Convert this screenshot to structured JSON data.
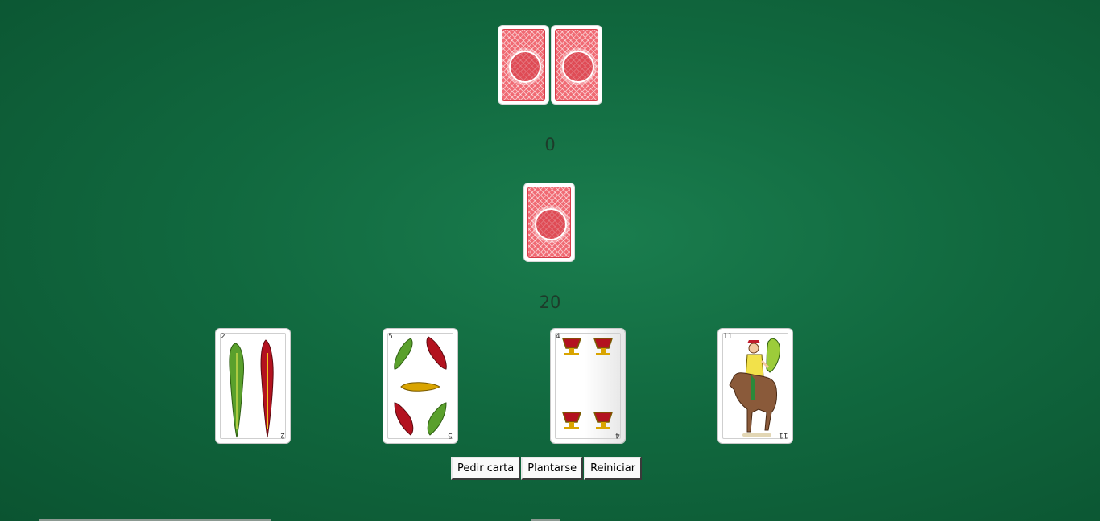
{
  "dealer": {
    "cards": [
      {
        "face": "back"
      },
      {
        "face": "back"
      }
    ],
    "score": "0"
  },
  "deck": {
    "face": "back"
  },
  "player": {
    "score": "20",
    "cards": [
      {
        "rank": "2",
        "suit": "bastos"
      },
      {
        "rank": "5",
        "suit": "bastos"
      },
      {
        "rank": "4",
        "suit": "copas"
      },
      {
        "rank": "11",
        "suit": "bastos"
      }
    ]
  },
  "controls": {
    "hit_label": "Pedir carta",
    "stand_label": "Plantarse",
    "reset_label": "Reiniciar"
  },
  "colors": {
    "table": "#11693f",
    "card_back": "#f06a73",
    "club_green": "#5aa02c",
    "club_red": "#b3121f",
    "cup_gold": "#d9a400"
  }
}
